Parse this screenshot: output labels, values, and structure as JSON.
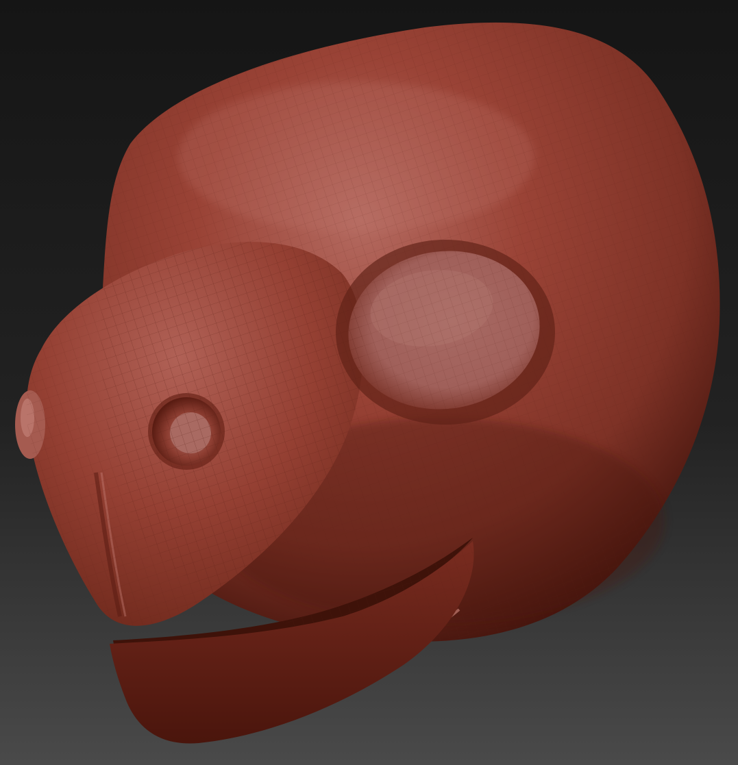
{
  "scene": {
    "subject": "sculpted-creature-head",
    "colors": {
      "background_top": "#151515",
      "background_bottom": "#4a4a4a",
      "clay_highlight": "#b9706a",
      "clay_base": "#9a4336",
      "clay_mid": "#7e3226",
      "clay_shadow": "#3a0f08",
      "eye_socket": "#a0605a",
      "wireframe": "#5a1e14"
    }
  }
}
